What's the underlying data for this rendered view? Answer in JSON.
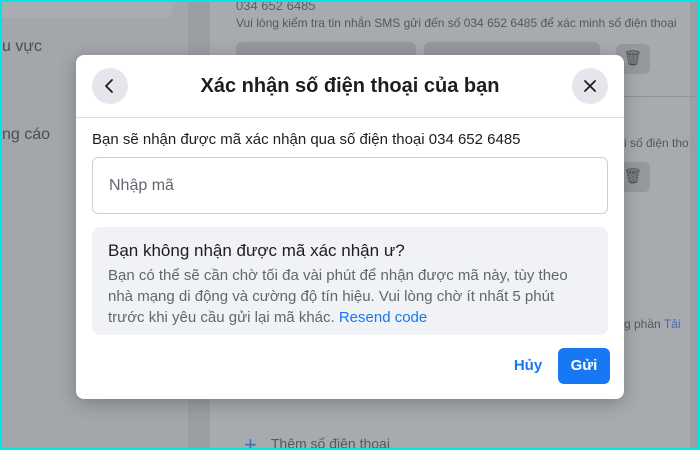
{
  "background": {
    "sidebar": {
      "item_1": "u vực",
      "item_2": "ng cáo"
    },
    "phone_number": "034 652 6485",
    "sms_notice": "Vui lòng kiểm tra tin nhắn SMS gửi đến số 034 652 6485 để xác minh số điện thoại",
    "side_snippet_1": "i số điện tho",
    "side_snippet_2": "g phần",
    "side_snippet_link": "Tải",
    "add_phone_label": "Thêm số điện thoại",
    "trash_icon": "trash-icon"
  },
  "modal": {
    "title": "Xác nhận số điện thoại của bạn",
    "back_icon": "chevron-left-icon",
    "close_icon": "close-icon",
    "description": "Bạn sẽ nhận được mã xác nhận qua số điện thoại 034 652 6485",
    "code_input": {
      "placeholder": "Nhập mã",
      "value": ""
    },
    "info": {
      "title": "Bạn không nhận được mã xác nhận ư?",
      "body": "Bạn có thể sẽ cần chờ tối đa vài phút để nhận được mã này, tùy theo nhà mạng di động và cường độ tín hiệu. Vui lòng chờ ít nhất 5 phút trước khi yêu cầu gửi lại mã khác.",
      "resend_link": "Resend code"
    },
    "cancel_label": "Hủy",
    "send_label": "Gửi"
  },
  "colors": {
    "accent": "#1877f2",
    "overlay_tint": "#9b9ea3",
    "screenshot_border": "#00e5e8"
  }
}
